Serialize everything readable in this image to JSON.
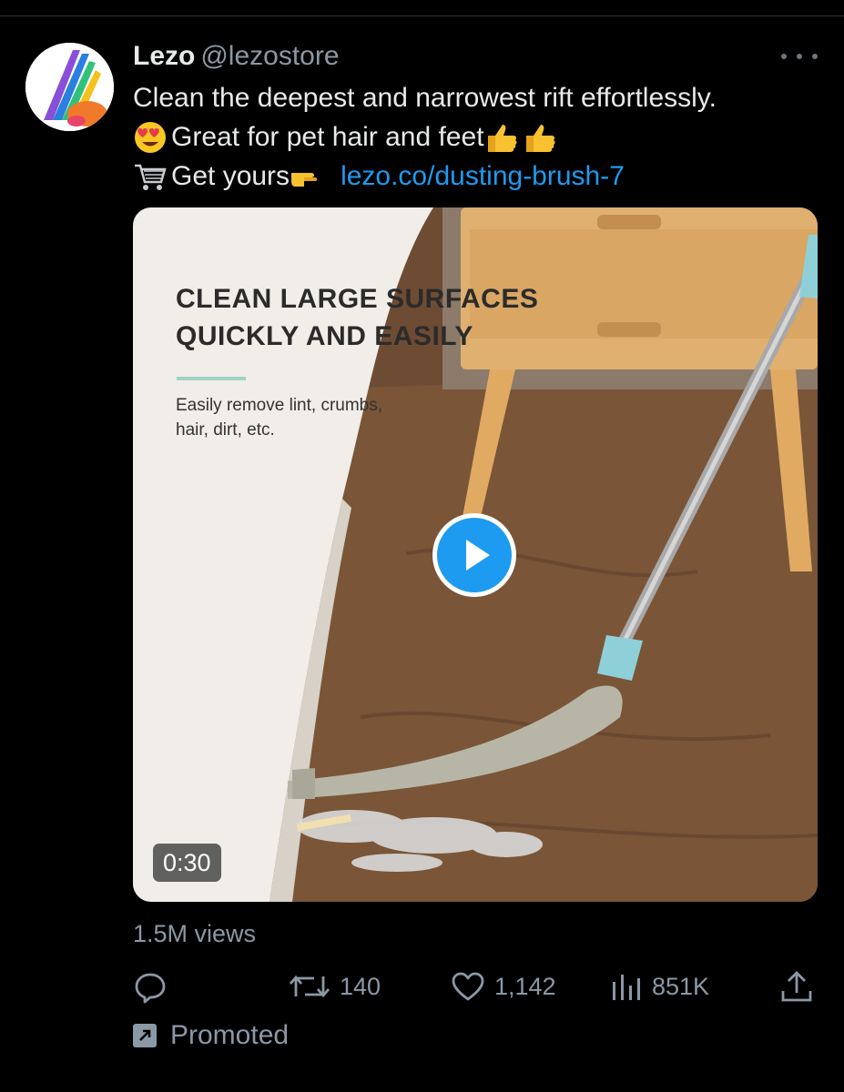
{
  "tweet": {
    "author_name": "Lezo",
    "author_handle": "@lezostore",
    "line1": "Clean the deepest and narrowest rift effortlessly.",
    "line2": "Great for pet hair and feet",
    "line3_prefix": "Get yours",
    "link": "lezo.co/dusting-brush-7",
    "emojis": [
      "heart-eyes-emoji",
      "thumbs-up-emoji",
      "thumbs-up-emoji",
      "shopping-cart-emoji",
      "pointing-right-emoji"
    ]
  },
  "video": {
    "overlay_title_1": "CLEAN LARGE SURFACES",
    "overlay_title_2": "QUICKLY AND EASILY",
    "overlay_sub_1": "Easily remove lint, crumbs,",
    "overlay_sub_2": "hair, dirt, etc.",
    "duration": "0:30",
    "play_icon": "play-icon"
  },
  "stats": {
    "views": "1.5M views",
    "retweets": "140",
    "likes": "1,142",
    "impressions": "851K"
  },
  "footer": {
    "promoted": "Promoted"
  },
  "colors": {
    "background": "#000000",
    "text": "#e7e9ea",
    "muted": "#8b98a5",
    "link": "#1d9bf0"
  }
}
